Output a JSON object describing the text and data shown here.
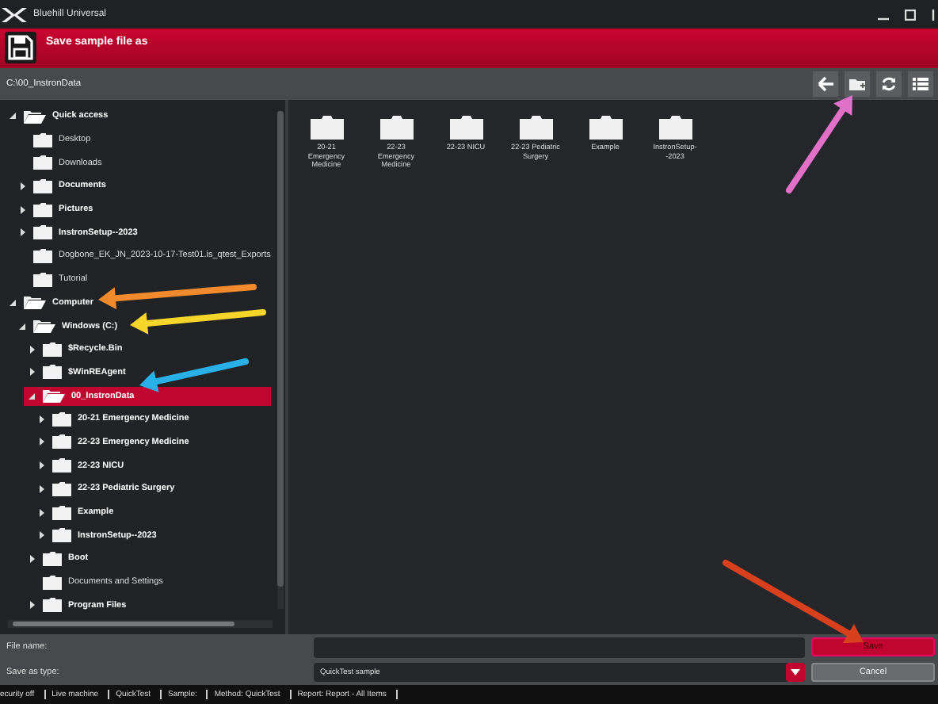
{
  "window": {
    "app_name": "Bluehill Universal",
    "title": "Save sample file as"
  },
  "path": "C:\\00_InstronData",
  "tree": [
    {
      "label": "Quick access",
      "expandable": true,
      "expanded": true,
      "selected": false,
      "children": [
        {
          "label": "Desktop",
          "expandable": false,
          "selected": false
        },
        {
          "label": "Downloads",
          "expandable": false,
          "selected": false
        },
        {
          "label": "Documents",
          "expandable": true,
          "expanded": false,
          "selected": false
        },
        {
          "label": "Pictures",
          "expandable": true,
          "expanded": false,
          "selected": false
        },
        {
          "label": "InstronSetup--2023",
          "expandable": true,
          "expanded": false,
          "selected": false
        },
        {
          "label": "Dogbone_EK_JN_2023-10-17-Test01.is_qtest_Exports",
          "expandable": false,
          "selected": false
        },
        {
          "label": "Tutorial",
          "expandable": false,
          "selected": false
        }
      ]
    },
    {
      "label": "Computer",
      "expandable": true,
      "expanded": true,
      "selected": false,
      "children": [
        {
          "label": "Windows (C:)",
          "expandable": true,
          "expanded": true,
          "selected": false,
          "children": [
            {
              "label": "$Recycle.Bin",
              "expandable": true,
              "expanded": false,
              "selected": false
            },
            {
              "label": "$WinREAgent",
              "expandable": true,
              "expanded": false,
              "selected": false
            },
            {
              "label": "00_InstronData",
              "expandable": true,
              "expanded": true,
              "selected": true,
              "children": [
                {
                  "label": "20-21 Emergency Medicine",
                  "expandable": true,
                  "expanded": false,
                  "selected": false
                },
                {
                  "label": "22-23 Emergency Medicine",
                  "expandable": true,
                  "expanded": false,
                  "selected": false
                },
                {
                  "label": "22-23 NICU",
                  "expandable": true,
                  "expanded": false,
                  "selected": false
                },
                {
                  "label": "22-23 Pediatric Surgery",
                  "expandable": true,
                  "expanded": false,
                  "selected": false
                },
                {
                  "label": "Example",
                  "expandable": true,
                  "expanded": false,
                  "selected": false
                },
                {
                  "label": "InstronSetup--2023",
                  "expandable": true,
                  "expanded": false,
                  "selected": false
                }
              ]
            },
            {
              "label": "Boot",
              "expandable": true,
              "expanded": false,
              "selected": false
            },
            {
              "label": "Documents and Settings",
              "expandable": false,
              "selected": false
            },
            {
              "label": "Program Files",
              "expandable": true,
              "expanded": false,
              "selected": false
            }
          ]
        }
      ]
    }
  ],
  "files": [
    {
      "name": "20-21 Emergency Medicine"
    },
    {
      "name": "22-23 Emergency Medicine"
    },
    {
      "name": "22-23 NICU"
    },
    {
      "name": "22-23 Pediatric Surgery"
    },
    {
      "name": "Example"
    },
    {
      "name": "InstronSetup--2023"
    }
  ],
  "form": {
    "file_name_label": "File name:",
    "type_label": "Save as type:",
    "type_value": "QuickTest sample",
    "save": "Save",
    "cancel": "Cancel"
  },
  "status_bar": [
    "ecurity off",
    "Live machine",
    "QuickTest",
    "Sample:",
    "Method: QuickTest",
    "Report: Report - All Items"
  ],
  "annotations": [
    {
      "color": "#f08a2c"
    },
    {
      "color": "#f5d52a"
    },
    {
      "color": "#2ab0e8"
    },
    {
      "color": "#e070c8"
    },
    {
      "color": "#d8401e"
    }
  ]
}
